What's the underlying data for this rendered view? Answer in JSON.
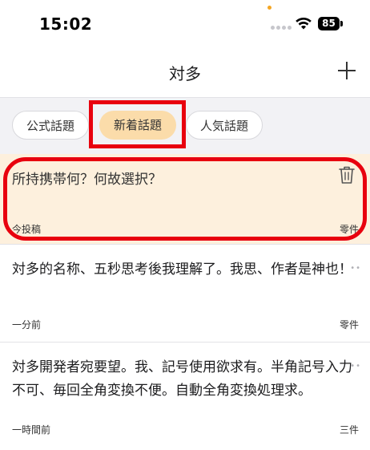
{
  "status_bar": {
    "time": "15:02",
    "battery": "85",
    "indicator_color": "#f5a623"
  },
  "nav": {
    "title": "対多",
    "add_icon": "plus-icon"
  },
  "tabs": [
    {
      "label": "公式話題",
      "selected": false
    },
    {
      "label": "新着話題",
      "selected": true
    },
    {
      "label": "人気話題",
      "selected": false
    }
  ],
  "highlighted_post": {
    "body": "所持携帯何？何故選択？",
    "time": "今投稿",
    "replies": "零件",
    "delete_icon": "trash-icon"
  },
  "posts": [
    {
      "body": "対多的名称、五秒思考後我理解了。我思、作者是神也！",
      "time": "一分前",
      "replies": "零件",
      "more": "••"
    },
    {
      "body": "対多開発者宛要望。我、記号使用欲求有。半角記号入力不可、毎回全角変換不便。自動全角変換処理求。",
      "time": "一時間前",
      "replies": "三件",
      "more": "••"
    }
  ],
  "colors": {
    "accent": "#fbdcaa",
    "highlight_bg": "#fdf0dd",
    "annotation": "#e8000e"
  }
}
